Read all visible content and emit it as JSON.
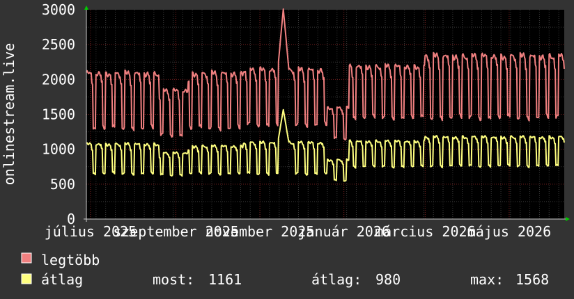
{
  "chart_data": {
    "type": "line",
    "ylabel": "onlinestream.live",
    "ylim": [
      0,
      3000
    ],
    "yticks": [
      0,
      500,
      1000,
      1500,
      2000,
      2500,
      3000
    ],
    "grid": true,
    "x_range": [
      "2025-06-28",
      "2026-06-10"
    ],
    "xtick_labels": [
      {
        "date": "2025-07-01",
        "label": "július 2025"
      },
      {
        "date": "2025-09-01",
        "label": "szeptember 2025"
      },
      {
        "date": "2025-11-01",
        "label": "november 2025"
      },
      {
        "date": "2026-01-01",
        "label": "január 2026"
      },
      {
        "date": "2026-03-01",
        "label": "március 2026"
      },
      {
        "date": "2026-05-01",
        "label": "május 2026"
      }
    ],
    "series": [
      {
        "name": "legtöbb",
        "color": "#f08080",
        "period_days": 7,
        "segments": [
          {
            "start": "2025-06-28",
            "end": "2025-08-20",
            "high": 2100,
            "low": 1300
          },
          {
            "start": "2025-08-20",
            "end": "2025-09-10",
            "high": 1850,
            "low": 1200
          },
          {
            "start": "2025-09-10",
            "end": "2025-10-20",
            "high": 2100,
            "low": 1300
          },
          {
            "start": "2025-10-20",
            "end": "2025-12-20",
            "high": 2150,
            "low": 1350
          },
          {
            "start": "2025-12-20",
            "end": "2026-01-05",
            "high": 1600,
            "low": 1150
          },
          {
            "start": "2026-01-05",
            "end": "2026-03-01",
            "high": 2200,
            "low": 1450
          },
          {
            "start": "2026-03-01",
            "end": "2026-06-10",
            "high": 2350,
            "low": 1450
          }
        ],
        "spikes": [
          {
            "date": "2025-11-18",
            "value": 3010
          }
        ]
      },
      {
        "name": "átlag",
        "color": "#ffff80",
        "period_days": 7,
        "segments": [
          {
            "start": "2025-06-28",
            "end": "2025-08-20",
            "high": 1080,
            "low": 650
          },
          {
            "start": "2025-08-20",
            "end": "2025-09-10",
            "high": 950,
            "low": 630
          },
          {
            "start": "2025-09-10",
            "end": "2025-10-20",
            "high": 1050,
            "low": 650
          },
          {
            "start": "2025-10-20",
            "end": "2025-12-20",
            "high": 1100,
            "low": 650
          },
          {
            "start": "2025-12-20",
            "end": "2026-01-05",
            "high": 850,
            "low": 550
          },
          {
            "start": "2026-01-05",
            "end": "2026-03-01",
            "high": 1120,
            "low": 750
          },
          {
            "start": "2026-03-01",
            "end": "2026-06-10",
            "high": 1180,
            "low": 760
          }
        ],
        "spikes": [
          {
            "date": "2025-11-18",
            "value": 1568
          }
        ]
      }
    ],
    "legend": [
      {
        "name": "legtöbb",
        "color": "#f08080"
      },
      {
        "name": "átlag",
        "color": "#ffff80"
      }
    ],
    "stats": {
      "most_label": "most:",
      "most_value": "1161",
      "atlag_label": "átlag:",
      "atlag_value": "980",
      "max_label": "max:",
      "max_value": "1568"
    }
  }
}
